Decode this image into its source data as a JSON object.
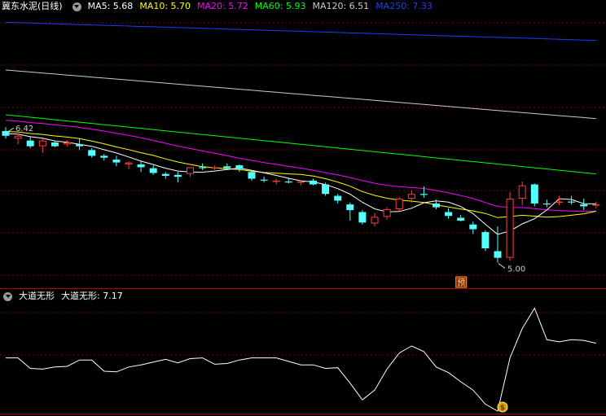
{
  "header": {
    "title": "冀东水泥(日线)",
    "ma": [
      {
        "label": "MA5: 5.68",
        "color": "#ffffff"
      },
      {
        "label": "MA10: 5.70",
        "color": "#ffff00"
      },
      {
        "label": "MA20: 5.72",
        "color": "#ff00ff"
      },
      {
        "label": "MA60: 5.93",
        "color": "#00ff00"
      },
      {
        "label": "MA120: 6.51",
        "color": "#cccccc"
      },
      {
        "label": "MA250: 7.33",
        "color": "#1e3cff"
      }
    ]
  },
  "sub_header": {
    "title": "大道无形",
    "value_label": "大道无形: 7.17"
  },
  "annotations": {
    "high_label": "6.42",
    "low_label": "5.00",
    "yu_badge": "预",
    "money_badge": "$"
  },
  "colors": {
    "up": "#ff3c3c",
    "down": "#54ffff",
    "grid": "#7a0000",
    "divider": "#b00000"
  },
  "chart_data": [
    {
      "type": "candlestick",
      "title": "冀东水泥(日线)",
      "ylim": [
        4.8,
        7.6
      ],
      "candles": [
        [
          6.38,
          6.42,
          6.3,
          6.33
        ],
        [
          6.3,
          6.35,
          6.24,
          6.33
        ],
        [
          6.28,
          6.32,
          6.2,
          6.22
        ],
        [
          6.22,
          6.3,
          6.15,
          6.28
        ],
        [
          6.26,
          6.27,
          6.21,
          6.22
        ],
        [
          6.24,
          6.28,
          6.22,
          6.26
        ],
        [
          6.24,
          6.3,
          6.18,
          6.22
        ],
        [
          6.18,
          6.2,
          6.1,
          6.12
        ],
        [
          6.12,
          6.14,
          6.07,
          6.1
        ],
        [
          6.08,
          6.12,
          6.01,
          6.05
        ],
        [
          6.03,
          6.06,
          5.98,
          6.05
        ],
        [
          6.03,
          6.07,
          5.95,
          6.0
        ],
        [
          5.99,
          6.02,
          5.92,
          5.94
        ],
        [
          5.93,
          5.95,
          5.88,
          5.91
        ],
        [
          5.92,
          5.95,
          5.84,
          5.9
        ],
        [
          5.93,
          5.97,
          5.9,
          6.0
        ],
        [
          6.0,
          6.04,
          5.97,
          5.99
        ],
        [
          5.99,
          6.02,
          5.96,
          6.0
        ],
        [
          6.01,
          6.04,
          5.97,
          5.99
        ],
        [
          6.02,
          6.03,
          5.95,
          5.98
        ],
        [
          5.95,
          5.97,
          5.86,
          5.88
        ],
        [
          5.87,
          5.9,
          5.84,
          5.86
        ],
        [
          5.85,
          5.88,
          5.82,
          5.86
        ],
        [
          5.85,
          5.88,
          5.83,
          5.84
        ],
        [
          5.84,
          5.86,
          5.81,
          5.85
        ],
        [
          5.86,
          5.88,
          5.81,
          5.82
        ],
        [
          5.82,
          5.84,
          5.7,
          5.72
        ],
        [
          5.7,
          5.72,
          5.62,
          5.65
        ],
        [
          5.61,
          5.63,
          5.44,
          5.55
        ],
        [
          5.53,
          5.55,
          5.4,
          5.42
        ],
        [
          5.41,
          5.52,
          5.38,
          5.48
        ],
        [
          5.48,
          5.58,
          5.45,
          5.56
        ],
        [
          5.56,
          5.69,
          5.54,
          5.67
        ],
        [
          5.67,
          5.76,
          5.63,
          5.72
        ],
        [
          5.72,
          5.8,
          5.68,
          5.71
        ],
        [
          5.62,
          5.66,
          5.56,
          5.58
        ],
        [
          5.53,
          5.57,
          5.46,
          5.49
        ],
        [
          5.47,
          5.5,
          5.43,
          5.44
        ],
        [
          5.4,
          5.43,
          5.3,
          5.35
        ],
        [
          5.32,
          5.34,
          5.12,
          5.15
        ],
        [
          5.12,
          5.38,
          5.0,
          5.05
        ],
        [
          5.05,
          5.74,
          5.02,
          5.67
        ],
        [
          5.67,
          5.85,
          5.6,
          5.81
        ],
        [
          5.82,
          5.83,
          5.59,
          5.62
        ],
        [
          5.62,
          5.66,
          5.58,
          5.61
        ],
        [
          5.63,
          5.7,
          5.6,
          5.64
        ],
        [
          5.64,
          5.7,
          5.61,
          5.63
        ],
        [
          5.61,
          5.67,
          5.55,
          5.59
        ],
        [
          5.6,
          5.64,
          5.57,
          5.61
        ]
      ],
      "ma_values": {
        "MA5": 5.68,
        "MA10": 5.7,
        "MA20": 5.72,
        "MA60": 5.93,
        "MA120": 6.51,
        "MA250": 7.33
      },
      "annotations": [
        "6.42",
        "5.00"
      ]
    },
    {
      "type": "line",
      "title": "大道无形",
      "series": [
        {
          "name": "大道无形",
          "values": [
            7.6,
            7.6,
            6.1,
            6.0,
            6.3,
            6.4,
            7.3,
            7.3,
            5.7,
            5.6,
            6.3,
            6.6,
            7.0,
            7.4,
            6.9,
            7.5,
            7.6,
            6.7,
            6.8,
            7.3,
            7.6,
            7.6,
            7.6,
            7.1,
            6.6,
            6.6,
            6.1,
            6.2,
            4.0,
            1.6,
            3.0,
            6.0,
            8.3,
            9.3,
            8.5,
            6.3,
            5.5,
            4.2,
            3.0,
            1.0,
            0.0,
            7.6,
            11.8,
            14.7,
            10.2,
            9.9,
            10.2,
            10.1,
            9.7
          ]
        }
      ],
      "current_value": 7.17
    }
  ]
}
